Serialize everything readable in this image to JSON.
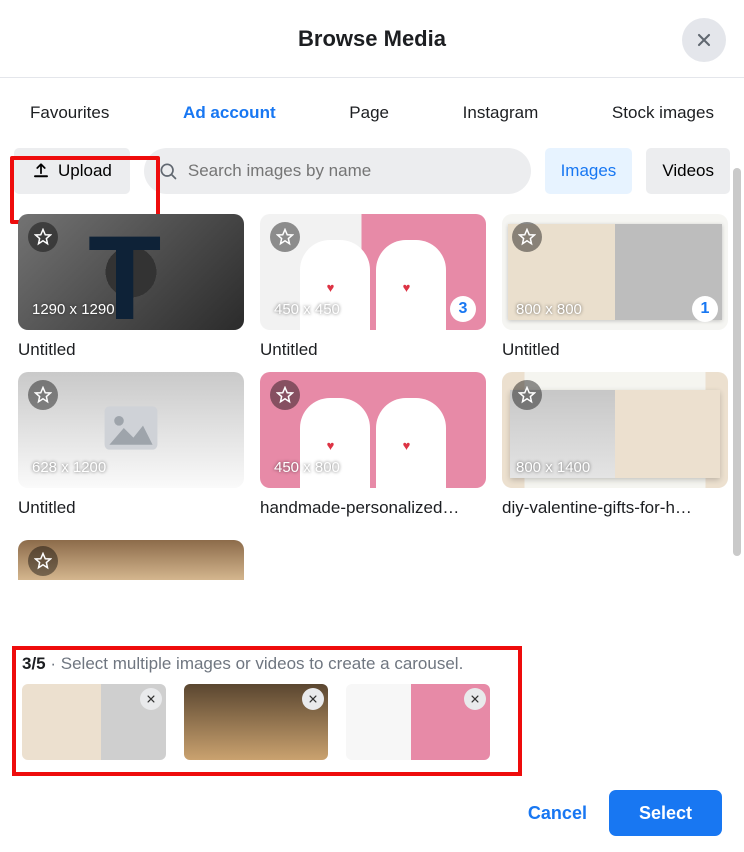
{
  "header": {
    "title": "Browse Media"
  },
  "tabs": {
    "items": [
      {
        "label": "Favourites",
        "active": false
      },
      {
        "label": "Ad account",
        "active": true
      },
      {
        "label": "Page",
        "active": false
      },
      {
        "label": "Instagram",
        "active": false
      },
      {
        "label": "Stock images",
        "active": false
      }
    ]
  },
  "toolbar": {
    "upload_label": "Upload",
    "search_placeholder": "Search images by name",
    "filter_images": "Images",
    "filter_videos": "Videos"
  },
  "items": [
    {
      "dims": "1290 x 1290",
      "caption": "Untitled",
      "badge": null
    },
    {
      "dims": "450 x 450",
      "caption": "Untitled",
      "badge": "3"
    },
    {
      "dims": "800 x 800",
      "caption": "Untitled",
      "badge": "1"
    },
    {
      "dims": "628 x 1200",
      "caption": "Untitled",
      "badge": null
    },
    {
      "dims": "450 x 800",
      "caption": "handmade-personalized…",
      "badge": null
    },
    {
      "dims": "800 x 1400",
      "caption": "diy-valentine-gifts-for-h…",
      "badge": null
    }
  ],
  "selection": {
    "count": "3/5",
    "hint": "Select multiple images or videos to create a carousel."
  },
  "footer": {
    "cancel": "Cancel",
    "select": "Select"
  }
}
